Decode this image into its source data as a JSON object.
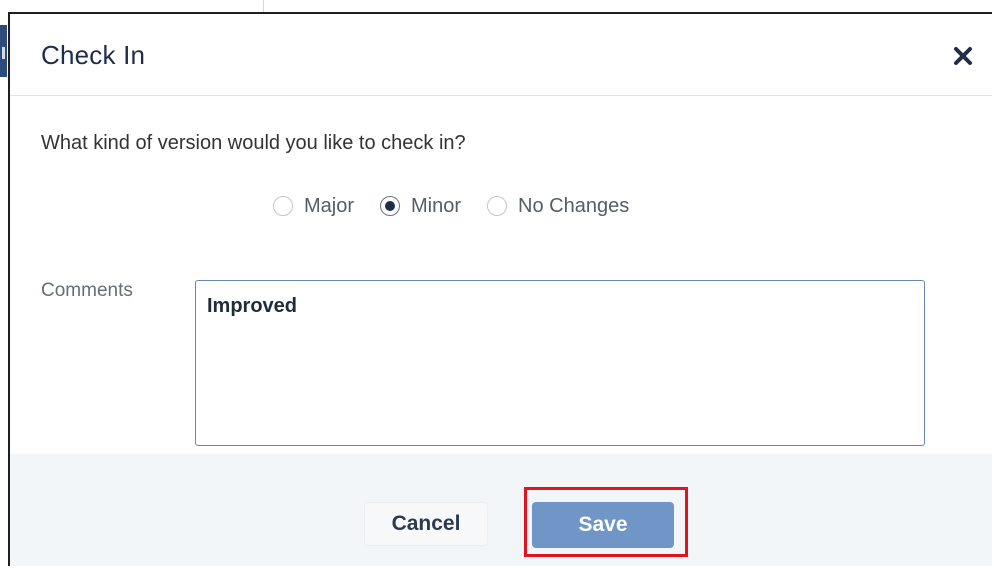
{
  "dialog": {
    "title": "Check In",
    "close_icon": "close-icon"
  },
  "form": {
    "question": "What kind of version would you like to check in?",
    "version_options": [
      {
        "label": "Major",
        "checked": false
      },
      {
        "label": "Minor",
        "checked": true
      },
      {
        "label": "No Changes",
        "checked": false
      }
    ],
    "comments_label": "Comments",
    "comments_value": "Improved"
  },
  "footer": {
    "cancel_label": "Cancel",
    "save_label": "Save"
  },
  "colors": {
    "title": "#1f2d4a",
    "save_button": "#6f96c7",
    "highlight": "#e0141c",
    "footer_bg": "#f2f6f9"
  }
}
